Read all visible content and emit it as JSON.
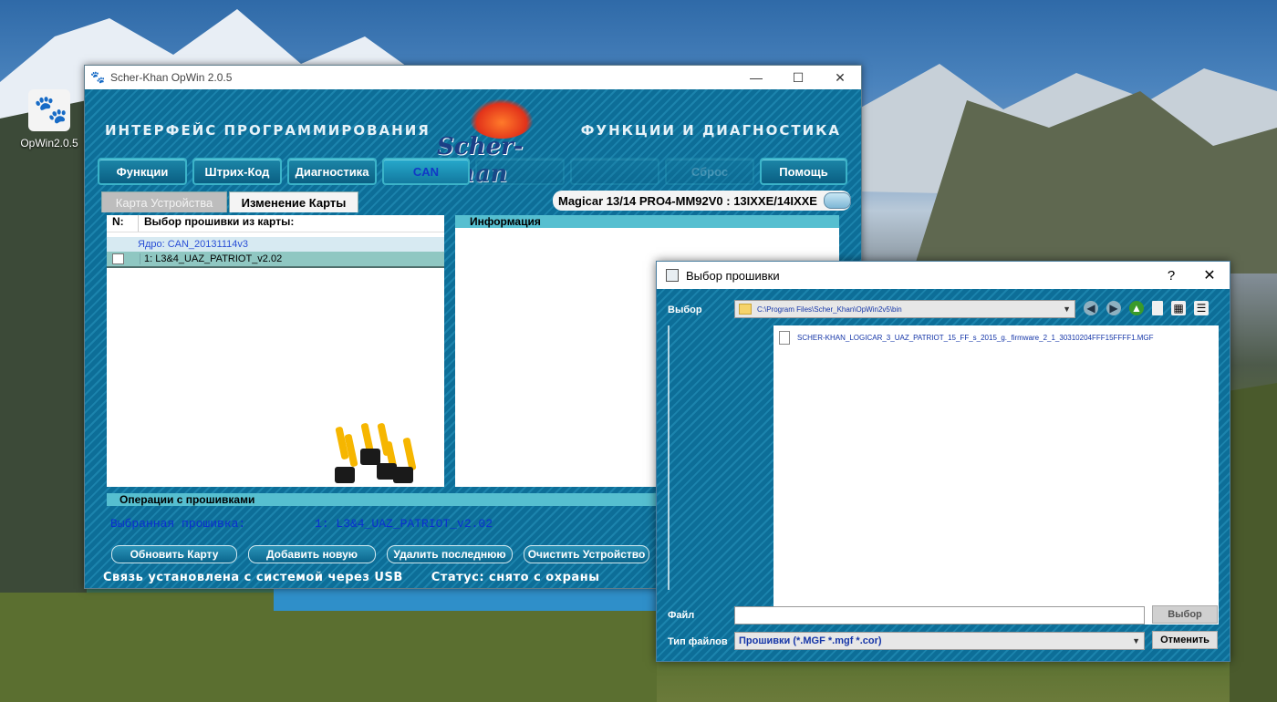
{
  "desktop": {
    "icon_label": "OpWin2.0.5"
  },
  "main_window": {
    "title": "Scher-Khan OpWin 2.0.5",
    "header_left": "ИНТЕРФЕЙС ПРОГРАММИРОВАНИЯ",
    "header_right": "ФУНКЦИИ И ДИАГНОСТИКА",
    "logo_text": "Scher-Khan",
    "toolbar": [
      {
        "label": "Функции"
      },
      {
        "label": "Штрих-Код"
      },
      {
        "label": "Диагностика"
      },
      {
        "label": "CAN"
      },
      {
        "label": ""
      },
      {
        "label": ""
      },
      {
        "label": "Сброс"
      },
      {
        "label": "Помощь"
      }
    ],
    "tabs": [
      "Карта Устройства",
      "Изменение Карты"
    ],
    "device": "Magicar 13/14 PRO4-MM92V0 : 13IXXE/14IXXE",
    "left_panel": {
      "col_n": "N:",
      "col_title": "Выбор прошивки из карты:",
      "core": "Ядро: CAN_20131114v3",
      "firmware_row": "1: L3&4_UAZ_PATRIOT_v2.02"
    },
    "info_title": "Информация",
    "ops_title": "Операции с прошивками",
    "selected_label": "Выбранная прошивка:",
    "selected_value": "1: L3&4_UAZ_PATRIOT_v2.02",
    "buttons": [
      "Обновить Карту",
      "Добавить новую",
      "Удалить последнюю",
      "Очистить Устройство"
    ],
    "status_connection": "Связь установлена с системой через USB",
    "status_state": "Статус: снято с охраны"
  },
  "dialog": {
    "title": "Выбор прошивки",
    "help": "?",
    "label_select": "Выбор",
    "path": "C:\\Program Files\\Scher_Khan\\OpWin2v5\\bin",
    "file": "SCHER-KHAN_LOGICAR_3_UAZ_PATRIOT_15_FF_s_2015_g._firmware_2_1_30310204FFF15FFFF1.MGF",
    "label_file": "Файл",
    "file_value": "",
    "label_type": "Тип файлов",
    "type_value": "Прошивки (*.MGF *.mgf *.cor)",
    "btn_select": "Выбор",
    "btn_cancel": "Отменить"
  }
}
